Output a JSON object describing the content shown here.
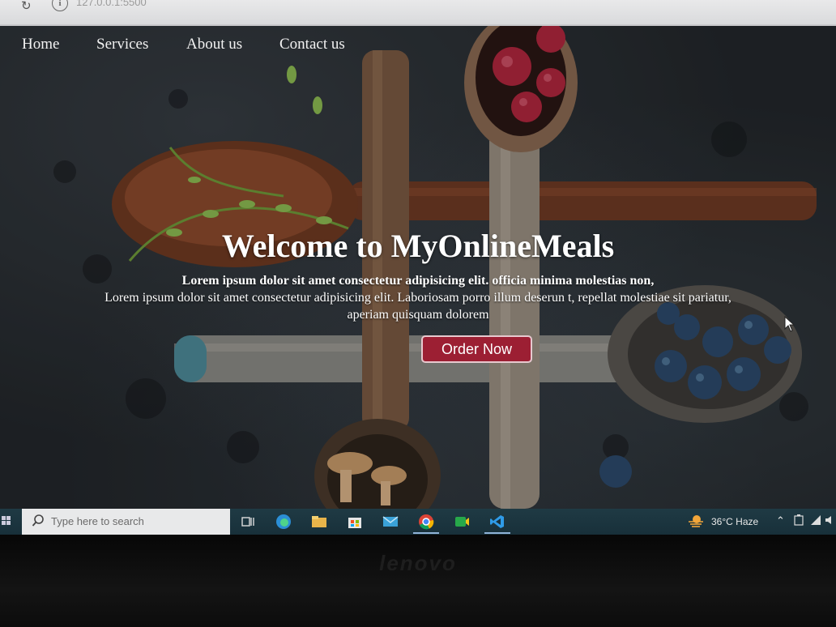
{
  "browser": {
    "url": "127.0.0.1:5500",
    "reload_icon": "reload-icon",
    "info_icon": "info-icon"
  },
  "nav": {
    "items": [
      {
        "label": "Home"
      },
      {
        "label": "Services"
      },
      {
        "label": "About us"
      },
      {
        "label": "Contact us"
      }
    ]
  },
  "hero": {
    "title": "Welcome to MyOnlineMeals",
    "line1": "Lorem ipsum dolor sit amet consectetur adipisicing elit. officia minima molestias non,",
    "line2": "Lorem ipsum dolor sit amet consectetur adipisicing elit. Laboriosam porro illum deserun t, repellat molestiae sit pariatur,",
    "line3": "aperiam quisquam dolorem",
    "cta_label": "Order Now",
    "accent_color": "#9c1f33"
  },
  "taskbar": {
    "search_placeholder": "Type here to search",
    "weather_temp": "36°C",
    "weather_desc": "Haze",
    "apps": [
      "task-view-icon",
      "edge-icon",
      "file-explorer-icon",
      "store-icon",
      "mail-icon",
      "chrome-icon",
      "camtasia-icon",
      "vscode-icon"
    ]
  },
  "device": {
    "brand": "lenovo"
  }
}
